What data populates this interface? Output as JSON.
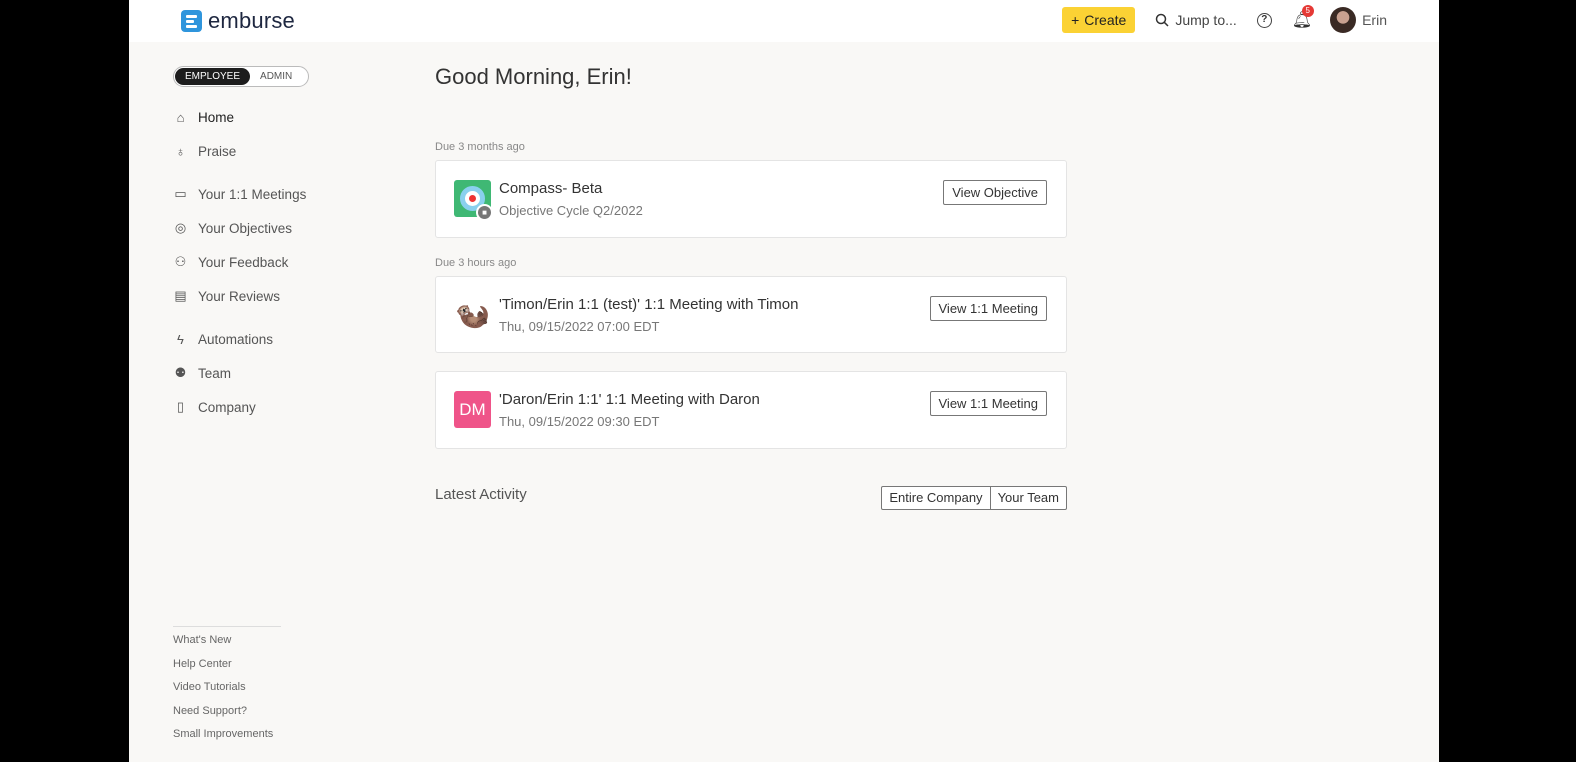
{
  "header": {
    "logo": "emburse",
    "create": "Create",
    "jump": "Jump to...",
    "notifications": "5",
    "user": "Erin"
  },
  "toggle": {
    "employee": "EMPLOYEE",
    "admin": "ADMIN"
  },
  "nav": [
    {
      "label": "Home",
      "icon": "home-icon"
    },
    {
      "label": "Praise",
      "icon": "award-icon"
    },
    {
      "label": "Your 1:1 Meetings",
      "icon": "chat-icon"
    },
    {
      "label": "Your Objectives",
      "icon": "target-icon"
    },
    {
      "label": "Your Feedback",
      "icon": "people-icon"
    },
    {
      "label": "Your Reviews",
      "icon": "document-icon"
    },
    {
      "label": "Automations",
      "icon": "bolt-icon"
    },
    {
      "label": "Team",
      "icon": "team-icon"
    },
    {
      "label": "Company",
      "icon": "building-icon"
    }
  ],
  "footer": [
    "What's New",
    "Help Center",
    "Video Tutorials",
    "Need Support?",
    "Small Improvements"
  ],
  "main": {
    "greeting": "Good Morning, Erin!",
    "due1": "Due 3 months ago",
    "objective": {
      "title": "Compass- Beta",
      "sub": "Objective Cycle Q2/2022",
      "button": "View Objective"
    },
    "due2": "Due 3 hours ago",
    "meeting1": {
      "title": "'Timon/Erin 1:1 (test)' 1:1 Meeting with Timon",
      "sub": "Thu, 09/15/2022 07:00 EDT",
      "button": "View 1:1 Meeting"
    },
    "meeting2": {
      "initials": "DM",
      "title": "'Daron/Erin 1:1' 1:1 Meeting with Daron",
      "sub": "Thu, 09/15/2022 09:30 EDT",
      "button": "View 1:1 Meeting"
    },
    "latest": "Latest Activity",
    "filters": [
      "Entire Company",
      "Your Team"
    ]
  }
}
